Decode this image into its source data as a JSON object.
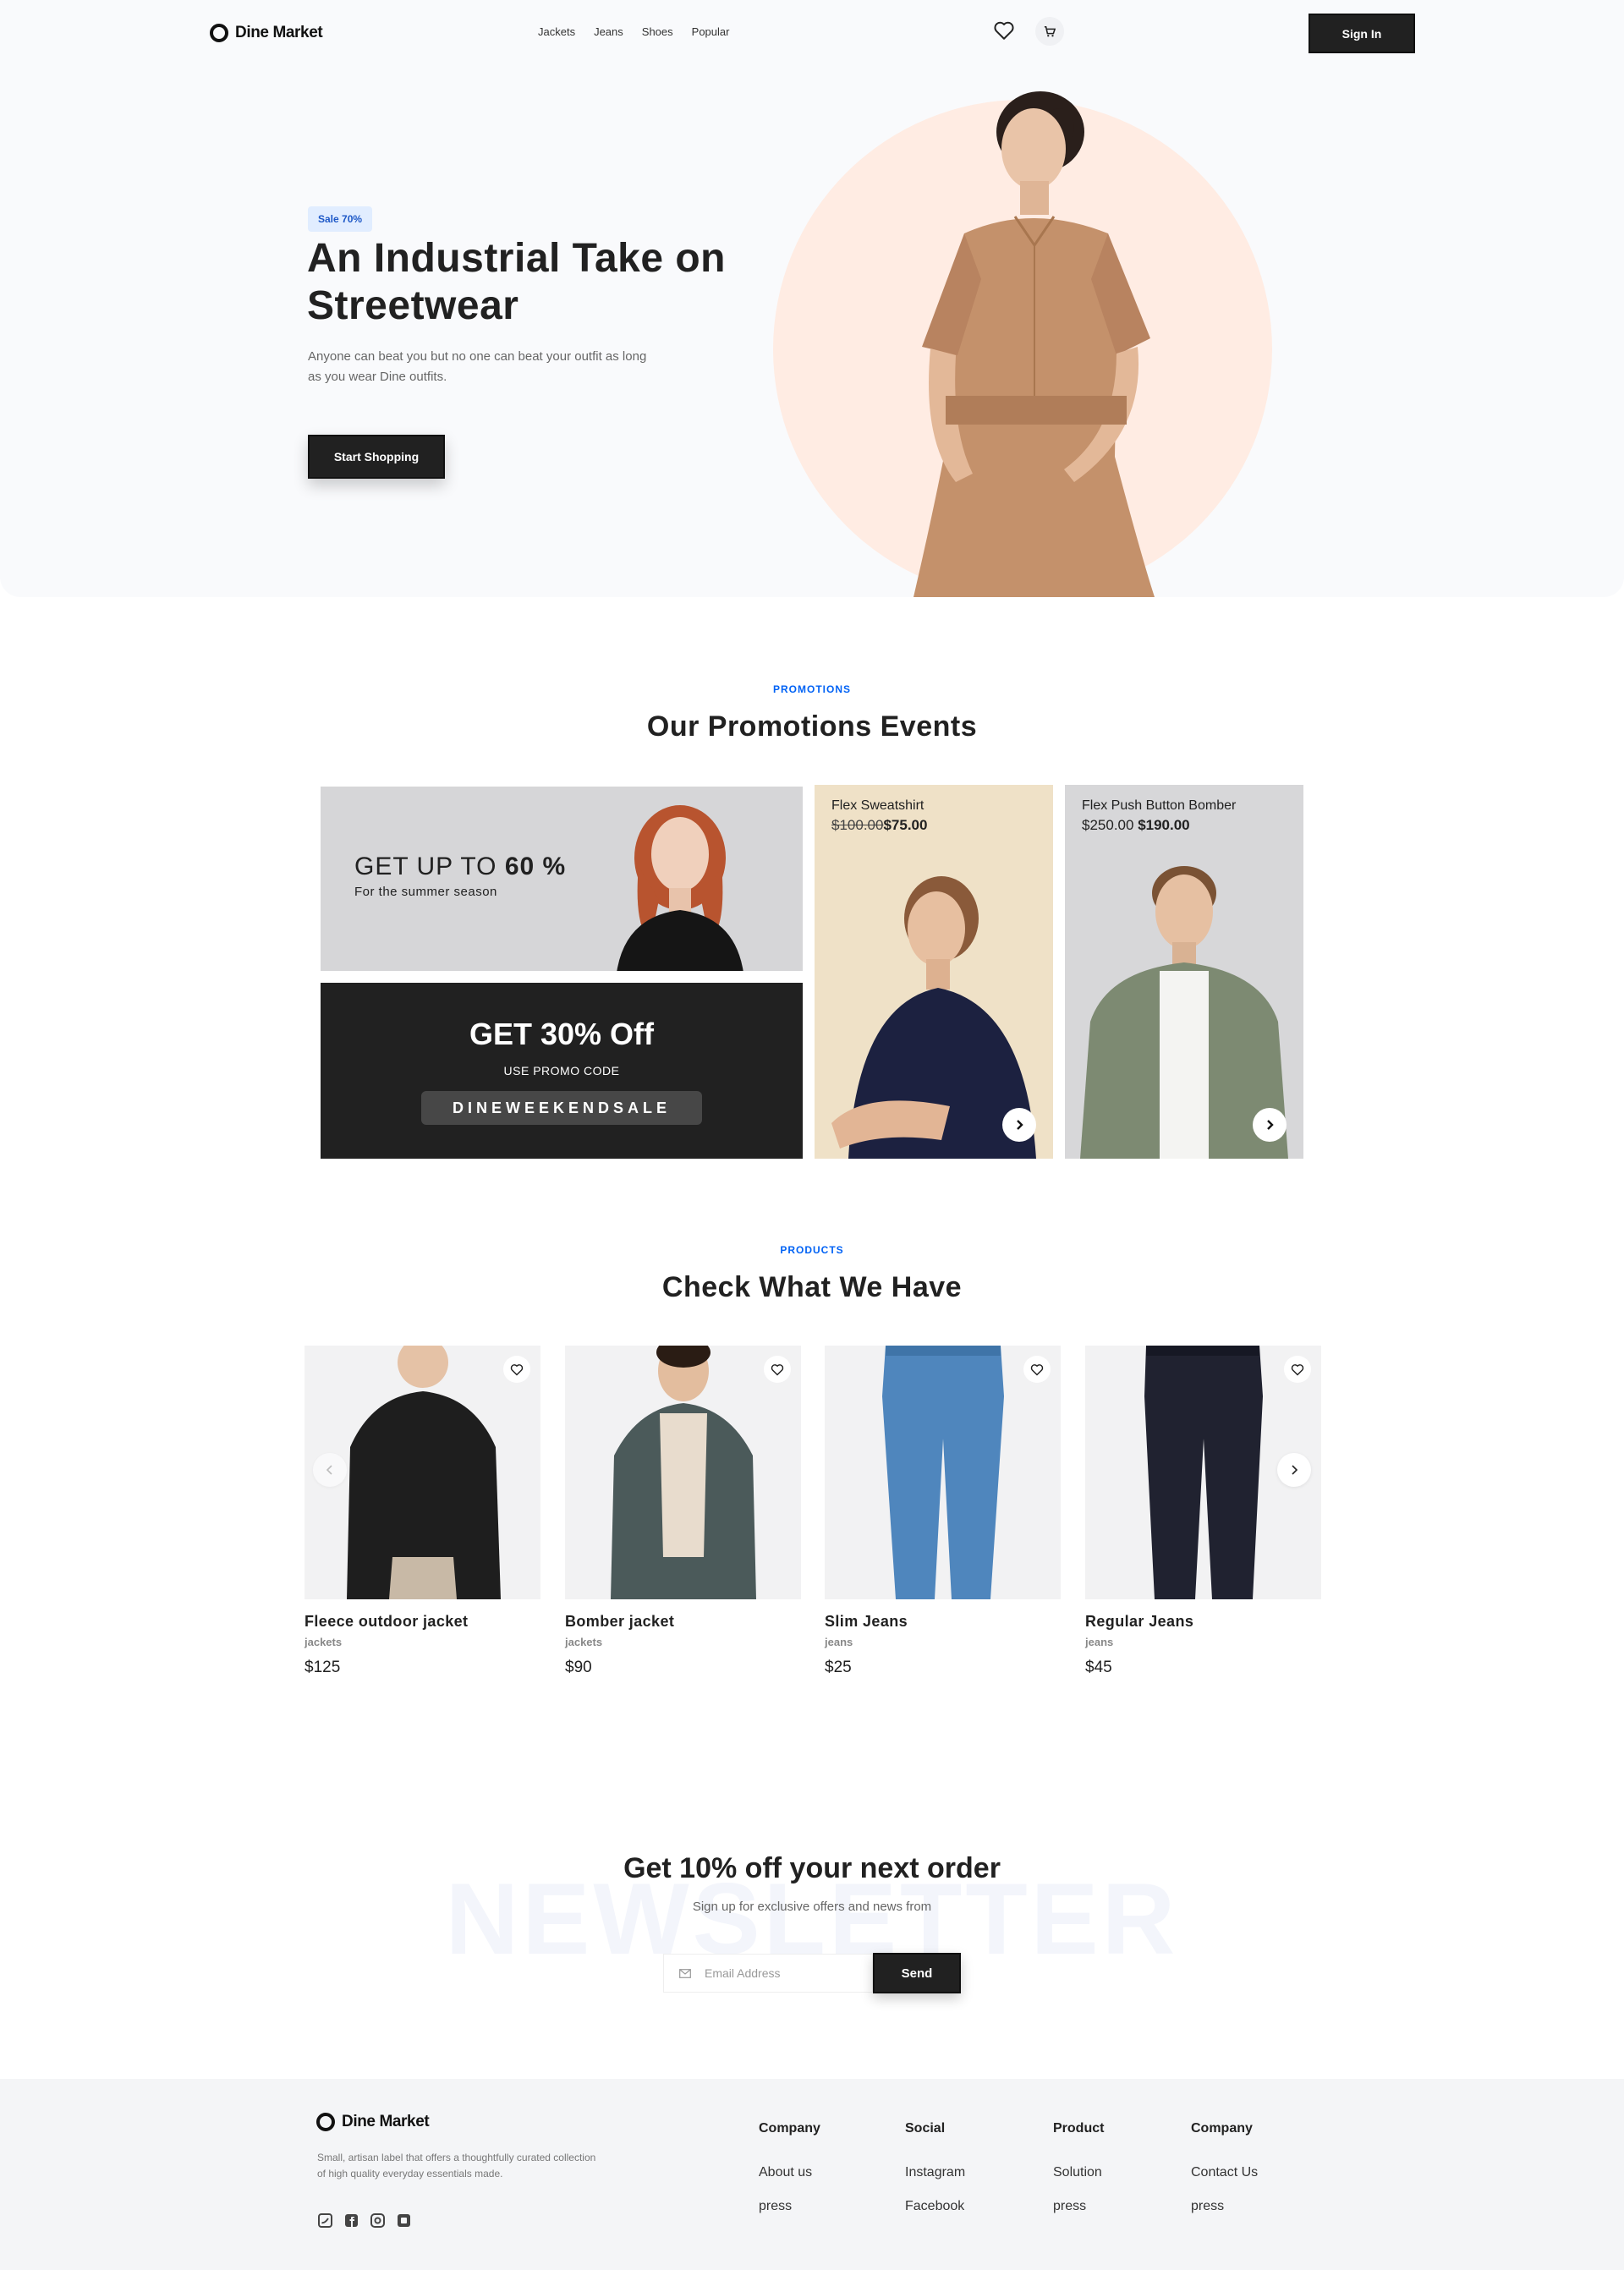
{
  "brand": {
    "name": "Dine Market"
  },
  "nav": {
    "links": [
      "Jackets",
      "Jeans",
      "Shoes",
      "Popular"
    ],
    "signin_label": "Sign In"
  },
  "hero": {
    "badge": "Sale 70%",
    "title": "An Industrial Take on Streetwear",
    "subtitle": "Anyone can beat you but no one can beat your outfit as long as you wear Dine outfits.",
    "cta": "Start Shopping"
  },
  "promotions": {
    "tag": "PROMOTIONS",
    "title": "Our Promotions Events",
    "banner_a": {
      "prefix": "GET UP TO ",
      "highlight": "60 %",
      "sub": "For the summer season"
    },
    "banner_b": {
      "title": "GET 30% Off",
      "use_label": "USE PROMO CODE",
      "code": "DINEWEEKENDSALE"
    },
    "cards": [
      {
        "name": "Flex Sweatshirt",
        "old_price": "$100.00",
        "new_price": "$75.00"
      },
      {
        "name": "Flex Push Button Bomber",
        "old_price": "$250.00",
        "new_price": "$190.00"
      }
    ]
  },
  "products": {
    "tag": "PRODUCTS",
    "title": "Check What We Have",
    "items": [
      {
        "name": "Fleece outdoor jacket",
        "category": "jackets",
        "price": "$125"
      },
      {
        "name": "Bomber jacket",
        "category": "jackets",
        "price": "$90"
      },
      {
        "name": "Slim Jeans",
        "category": "jeans",
        "price": "$25"
      },
      {
        "name": "Regular Jeans",
        "category": "jeans",
        "price": "$45"
      }
    ]
  },
  "newsletter": {
    "bg_text": "NEWSLETTER",
    "title": "Get 10% off your next order",
    "subtitle": "Sign up for exclusive offers and news from",
    "placeholder": "Email Address",
    "send": "Send"
  },
  "footer": {
    "description": "Small, artisan label that offers a thoughtfully curated collection of high quality everyday essentials made.",
    "social_icons": [
      "twitter-icon",
      "facebook-icon",
      "instagram-icon",
      "linkedin-icon"
    ],
    "columns": [
      {
        "heading": "Company",
        "links": [
          "About us",
          "press"
        ]
      },
      {
        "heading": "Social",
        "links": [
          "Instagram",
          "Facebook"
        ]
      },
      {
        "heading": "Product",
        "links": [
          "Solution",
          "press"
        ]
      },
      {
        "heading": "Company",
        "links": [
          "Contact Us",
          "press"
        ]
      }
    ]
  },
  "colors": {
    "accent": "#0062f5",
    "dark": "#212121",
    "hero_circle": "#ffece3",
    "badge_bg": "#e1edff"
  }
}
